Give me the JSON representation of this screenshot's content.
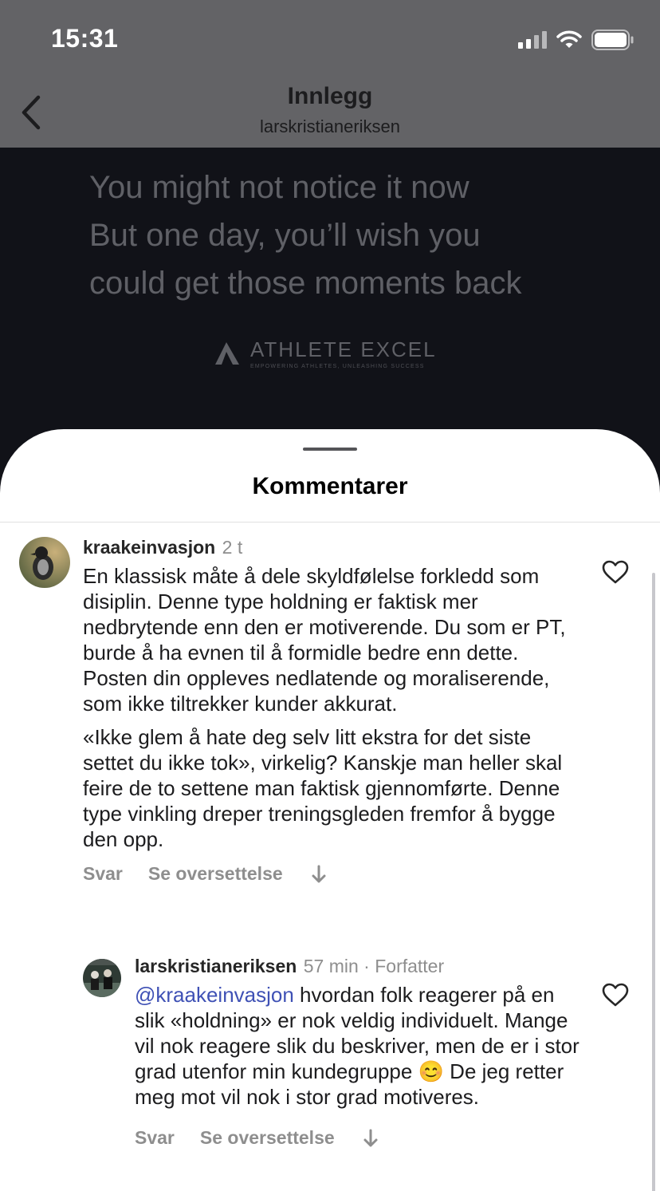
{
  "status": {
    "time": "15:31"
  },
  "nav": {
    "title": "Innlegg",
    "subtitle": "larskristianeriksen"
  },
  "post": {
    "lines": [
      "You might not notice it now",
      "But one day, you’ll wish you",
      "could get those moments back"
    ],
    "logo_name": "ATHLETE EXCEL",
    "logo_tagline": "EMPOWERING ATHLETES, UNLEASHING SUCCESS"
  },
  "sheet": {
    "title": "Kommentarer"
  },
  "comments": [
    {
      "username": "kraakeinvasjon",
      "time": "2 t",
      "paragraphs": [
        "En klassisk måte å dele skyldfølelse forkledd som disiplin. Denne type holdning er faktisk mer nedbrytende enn den er motiverende. Du som er PT, burde å ha evnen til å formidle bedre enn dette. Posten din oppleves nedlatende og moraliserende, som ikke tiltrekker kunder akkurat.",
        "«Ikke glem å hate deg selv litt ekstra for det siste settet du ikke tok», virkelig? Kanskje man heller skal feire de to settene man faktisk gjennomførte. Denne type vinkling dreper treningsgleden fremfor å bygge den opp."
      ],
      "reply_label": "Svar",
      "translate_label": "Se oversettelse"
    },
    {
      "username": "larskristianeriksen",
      "time": "57 min · Forfatter",
      "mention": "@kraakeinvasjon",
      "text_before_emoji": " hvordan folk reagerer på en slik «holdning» er nok veldig individuelt. Mange vil nok reagere slik du beskriver, men de er i stor grad utenfor min kundegruppe ",
      "emoji": "😊",
      "text_after_emoji": " De jeg retter meg mot vil nok i stor grad motiveres.",
      "reply_label": "Svar",
      "translate_label": "Se oversettelse"
    }
  ]
}
